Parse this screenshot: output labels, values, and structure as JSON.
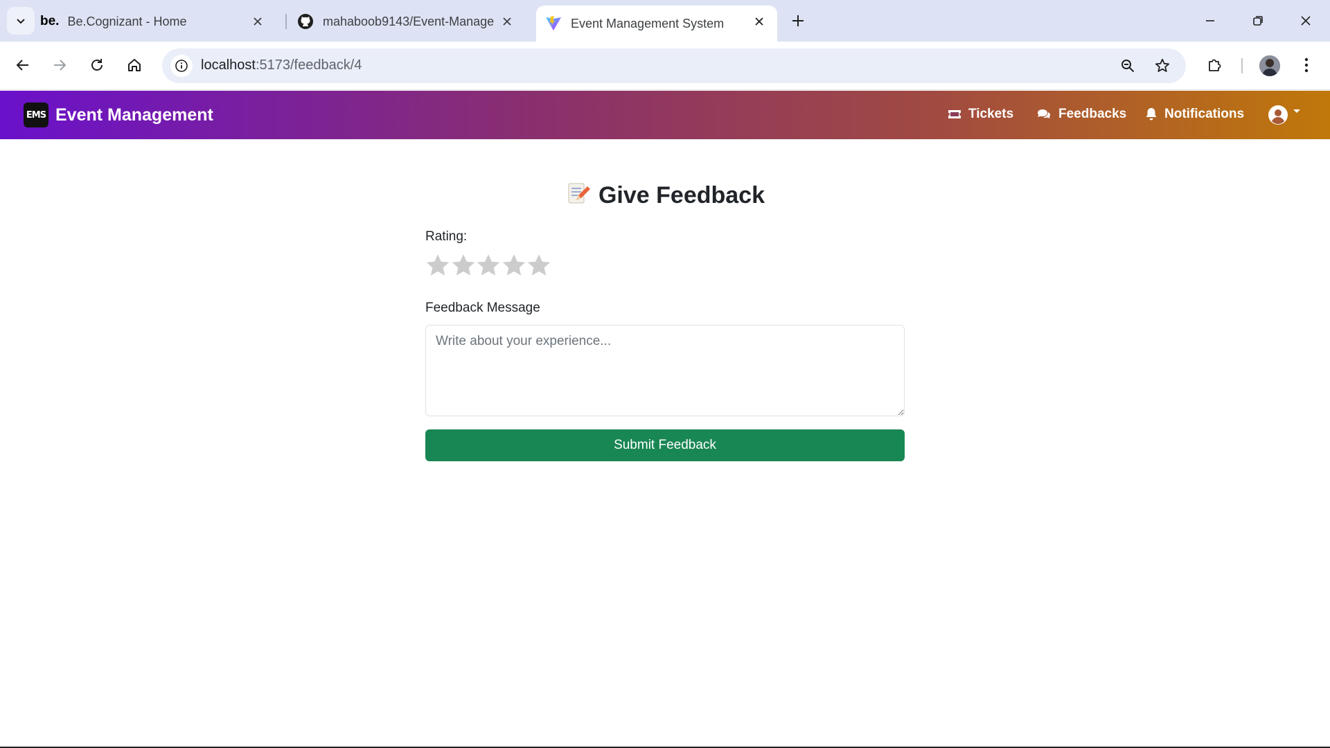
{
  "browser": {
    "tabs": [
      {
        "title": "Be.Cognizant - Home",
        "favicon_text": "be."
      },
      {
        "title": "mahaboob9143/Event-Manage",
        "favicon": "github-icon"
      },
      {
        "title": "Event Management System",
        "favicon": "vite-icon",
        "active": true
      }
    ],
    "url_host": "localhost",
    "url_path": ":5173/feedback/4"
  },
  "navbar": {
    "brand_logo": "EMS",
    "brand": "Event Management",
    "links": [
      {
        "label": "Tickets",
        "icon": "ticket-icon"
      },
      {
        "label": "Feedbacks",
        "icon": "comments-icon"
      },
      {
        "label": "Notifications",
        "icon": "bell-icon"
      }
    ],
    "gradient": [
      "#6a11cb",
      "#c0780a"
    ]
  },
  "feedback": {
    "title": "Give Feedback",
    "rating_label": "Rating:",
    "rating_value": 0,
    "rating_max": 5,
    "message_label": "Feedback Message",
    "message_placeholder": "Write about your experience...",
    "message_value": "",
    "submit_label": "Submit Feedback",
    "submit_color": "#198754"
  }
}
